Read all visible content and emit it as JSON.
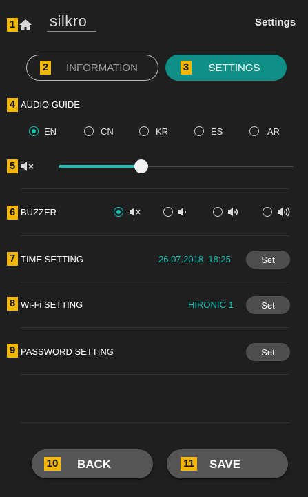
{
  "header": {
    "logo": "silkro",
    "title": "Settings",
    "home_icon": "home-icon"
  },
  "badges": [
    "1",
    "2",
    "3",
    "4",
    "5",
    "6",
    "7",
    "8",
    "9",
    "10",
    "11"
  ],
  "tabs": {
    "information": "INFORMATION",
    "settings": "SETTINGS"
  },
  "audio_guide": {
    "label": "AUDIO GUIDE",
    "languages": [
      "EN",
      "CN",
      "KR",
      "ES",
      "AR"
    ],
    "selected": "EN"
  },
  "volume": {
    "icon": "speaker-mute-icon",
    "level": 0.35
  },
  "buzzer": {
    "label": "BUZZER",
    "options": [
      "mute",
      "low",
      "medium",
      "high"
    ],
    "selected": "mute"
  },
  "time_setting": {
    "label": "TIME SETTING",
    "value": "26.07.2018  18:25",
    "button": "Set"
  },
  "wifi_setting": {
    "label": "Wi-Fi SETTING",
    "value": "HIRONIC 1",
    "button": "Set"
  },
  "password_setting": {
    "label": "PASSWORD SETTING",
    "button": "Set"
  },
  "footer": {
    "back": "BACK",
    "save": "SAVE"
  },
  "colors": {
    "accent": "#12c2b3",
    "tab_active": "#0f8f86",
    "badge": "#f2b705",
    "background": "#1f1f1f"
  }
}
